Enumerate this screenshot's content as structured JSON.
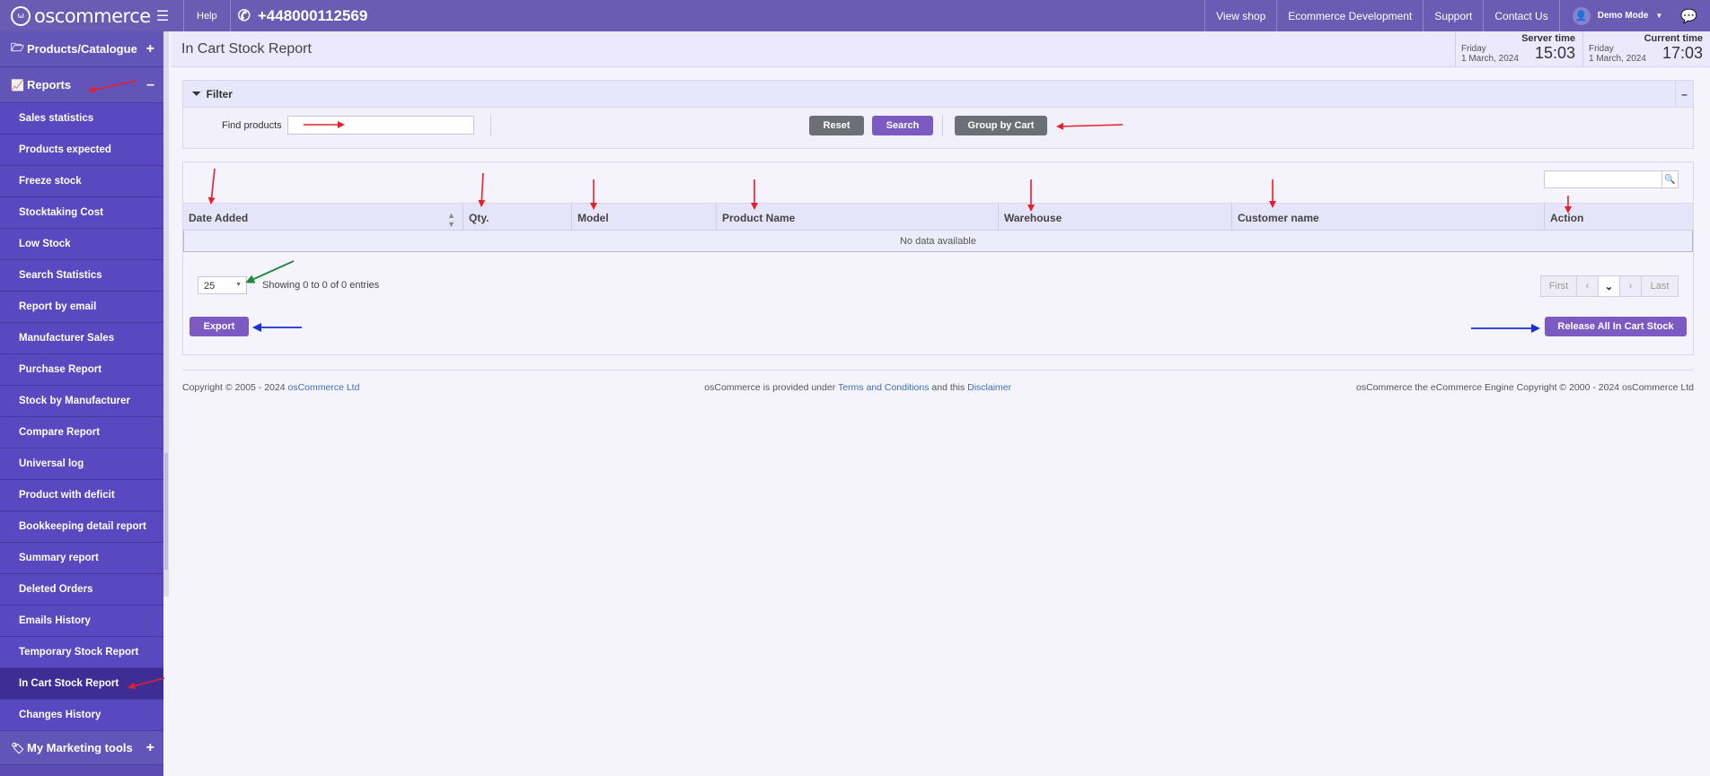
{
  "topbar": {
    "logo_text": "oscommerce",
    "help_label": "Help",
    "phone": "+448000112569",
    "links": [
      "View shop",
      "Ecommerce Development",
      "Support",
      "Contact Us"
    ],
    "user_label": "Demo Mode"
  },
  "sidebar": {
    "catalogue_label": "Products/Catalogue",
    "reports_label": "Reports",
    "items": [
      "Sales statistics",
      "Products expected",
      "Freeze stock",
      "Stocktaking Cost",
      "Low Stock",
      "Search Statistics",
      "Report by email",
      "Manufacturer Sales",
      "Purchase Report",
      "Stock by Manufacturer",
      "Compare Report",
      "Universal log",
      "Product with deficit",
      "Bookkeeping detail report",
      "Summary report",
      "Deleted Orders",
      "Emails History",
      "Temporary Stock Report",
      "In Cart Stock Report",
      "Changes History"
    ],
    "active_item": "In Cart Stock Report",
    "marketing_label": "My Marketing tools"
  },
  "header": {
    "title": "In Cart Stock Report",
    "server_time": {
      "label": "Server time",
      "day": "Friday",
      "date": "1 March, 2024",
      "time": "15:03"
    },
    "current_time": {
      "label": "Current time",
      "day": "Friday",
      "date": "1 March, 2024",
      "time": "17:03"
    }
  },
  "filter": {
    "title": "Filter",
    "collapse_glyph": "–",
    "find_label": "Find products",
    "find_value": "",
    "reset_label": "Reset",
    "search_label": "Search",
    "group_label": "Group by Cart"
  },
  "table": {
    "columns": [
      "Date Added",
      "Qty.",
      "Model",
      "Product Name",
      "Warehouse",
      "Customer name",
      "Action"
    ],
    "empty_text": "No data available",
    "page_size": "25",
    "entries_text": "Showing 0 to 0 of 0 entries",
    "pager": {
      "first": "First",
      "last": "Last"
    },
    "export_label": "Export",
    "release_label": "Release All In Cart Stock"
  },
  "footer": {
    "left_prefix": "Copyright © 2005 - 2024",
    "left_link": "osCommerce Ltd",
    "mid_prefix": "osCommerce is provided under",
    "mid_link1": "Terms and Conditions",
    "mid_and": "and this",
    "mid_link2": "Disclaimer",
    "right_text": "osCommerce the eCommerce Engine Copyright © 2000 - 2024 osCommerce Ltd"
  },
  "colors": {
    "topbar": "#6a5bb3",
    "sidebar": "#5b4bb2",
    "accent_button": "#7b5bc2",
    "grey_button": "#6c6f76",
    "annotation_red": "#e5202a",
    "annotation_green": "#1d8a3a",
    "annotation_blue": "#1a2fd6"
  }
}
